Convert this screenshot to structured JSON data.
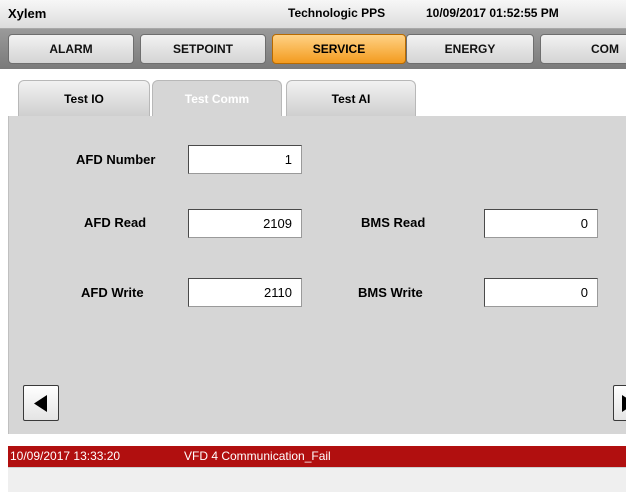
{
  "titlebar": {
    "app_name": "Xylem",
    "product": "Technologic PPS",
    "datetime": "10/09/2017 01:52:55 PM"
  },
  "nav_tabs": [
    {
      "label": "ALARM",
      "active": false
    },
    {
      "label": "SETPOINT",
      "active": false
    },
    {
      "label": "SERVICE",
      "active": true
    },
    {
      "label": "ENERGY",
      "active": false
    },
    {
      "label": "COM",
      "active": false
    }
  ],
  "sub_tabs": [
    {
      "label": "Test IO",
      "active": false
    },
    {
      "label": "Test Comm",
      "active": true
    },
    {
      "label": "Test AI",
      "active": false
    }
  ],
  "fields": {
    "afd_number": {
      "label": "AFD Number",
      "value": "1"
    },
    "afd_read": {
      "label": "AFD Read",
      "value": "2109"
    },
    "afd_write": {
      "label": "AFD Write",
      "value": "2110"
    },
    "bms_read": {
      "label": "BMS Read",
      "value": "0"
    },
    "bms_write": {
      "label": "BMS Write",
      "value": "0"
    }
  },
  "nav_buttons": {
    "prev_icon": "left-triangle-icon",
    "next_icon": "right-triangle-icon"
  },
  "alarm": {
    "timestamp": "10/09/2017 13:33:20",
    "message": "VFD 4 Communication_Fail"
  },
  "colors": {
    "active_tab": "#f39b1f",
    "alarm_bar": "#b10f0f",
    "panel": "#d6d6d6"
  }
}
